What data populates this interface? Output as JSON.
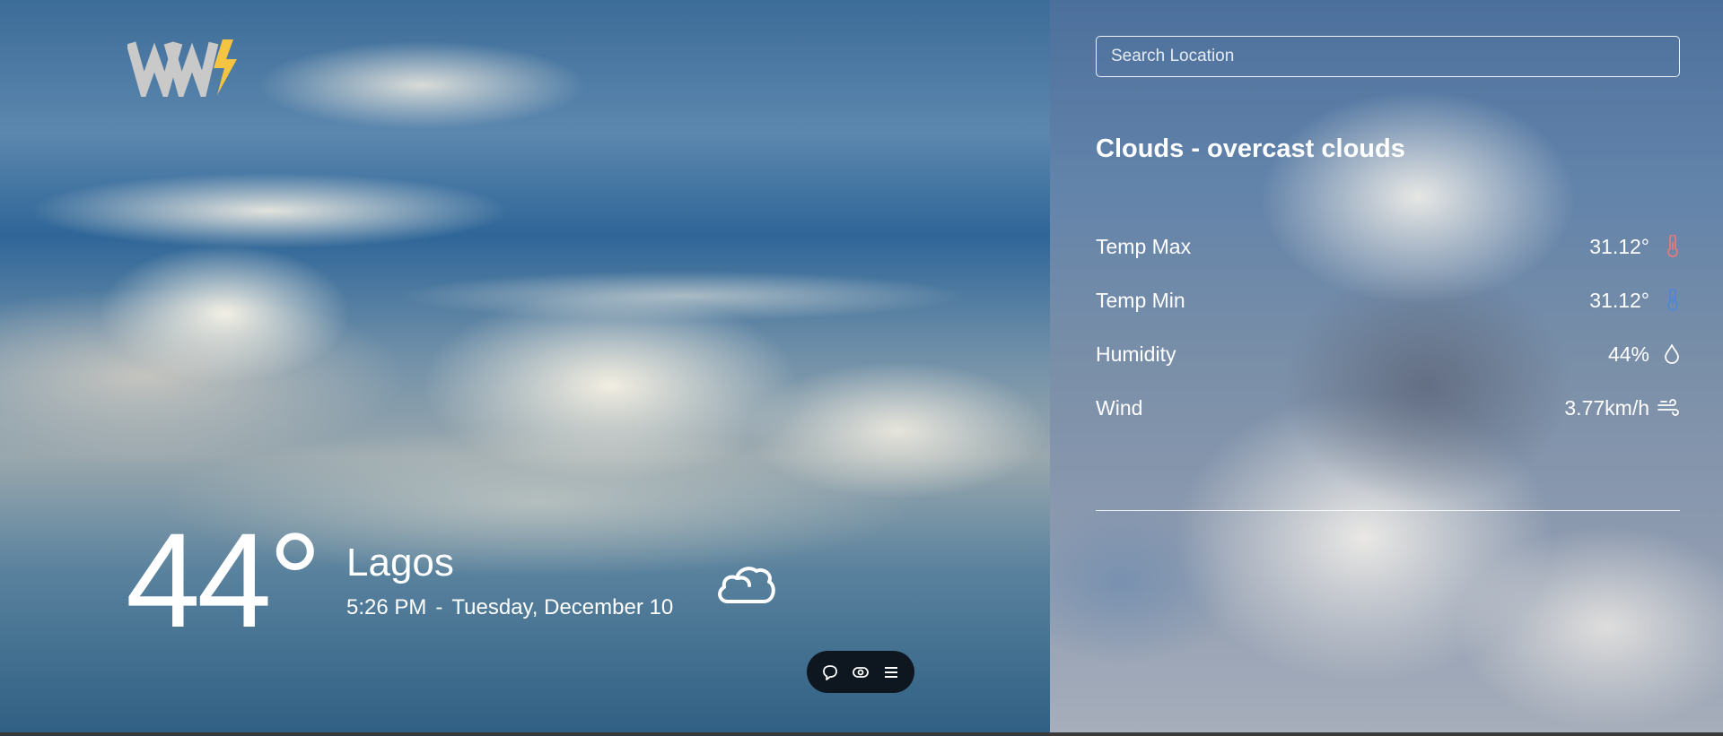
{
  "hero": {
    "temperature": "44°",
    "city": "Lagos",
    "time": "5:26 PM",
    "separator": "-",
    "date": "Tuesday, December 10",
    "weather_icon": "cloud-icon",
    "logo_icon": "ww-lightning-logo"
  },
  "toolbar": {
    "buttons": [
      {
        "icon": "chat-bubble-icon"
      },
      {
        "icon": "eye-toggle-icon"
      },
      {
        "icon": "menu-icon"
      }
    ]
  },
  "panel": {
    "search": {
      "placeholder": "Search Location",
      "value": ""
    },
    "condition": "Clouds - overcast clouds",
    "details": [
      {
        "label": "Temp Max",
        "value": "31.12°",
        "icon": "thermometer-hot-icon",
        "icon_color": "#e8797a"
      },
      {
        "label": "Temp Min",
        "value": "31.12°",
        "icon": "thermometer-cold-icon",
        "icon_color": "#4f86d8"
      },
      {
        "label": "Humidity",
        "value": "44%",
        "icon": "droplet-icon",
        "icon_color": "#ffffff"
      },
      {
        "label": "Wind",
        "value": "3.77km/h",
        "icon": "wind-icon",
        "icon_color": "#ffffff"
      }
    ]
  },
  "colors": {
    "logo_gray": "#c9c9c9",
    "logo_bolt": "#f5c542",
    "pill_bg": "#0e1720"
  }
}
